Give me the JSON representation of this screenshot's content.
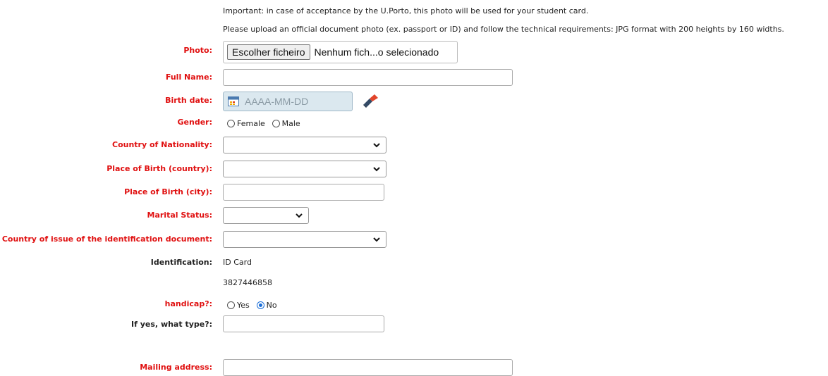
{
  "notes": {
    "line1": "Important: in case of acceptance by the U.Porto, this photo will be used for your student card.",
    "line2": "Please upload an official document photo (ex. passport or ID) and follow the technical requirements: JPG format with 200 heights by 160 widths."
  },
  "photo": {
    "label": "Photo:",
    "button": "Escolher ficheiro",
    "status": "Nenhum fich...o selecionado"
  },
  "full_name": {
    "label": "Full Name:",
    "value": ""
  },
  "birth_date": {
    "label": "Birth date:",
    "placeholder": "AAAA-MM-DD"
  },
  "gender": {
    "label": "Gender:",
    "options": [
      "Female",
      "Male"
    ],
    "selected": ""
  },
  "nationality": {
    "label": "Country of Nationality:",
    "value": ""
  },
  "birth_country": {
    "label": "Place of Birth (country):",
    "value": ""
  },
  "birth_city": {
    "label": "Place of Birth (city):",
    "value": ""
  },
  "marital": {
    "label": "Marital Status:",
    "value": ""
  },
  "id_country": {
    "label": "Country of issue of the identification document:",
    "value": ""
  },
  "identification": {
    "label": "Identification:",
    "type": "ID Card",
    "number": "3827446858"
  },
  "handicap": {
    "label": "handicap?:",
    "options": [
      "Yes",
      "No"
    ],
    "selected": "No"
  },
  "handicap_type": {
    "label": "If yes, what type?:",
    "value": ""
  },
  "mailing": {
    "label": "Mailing address:",
    "value": ""
  },
  "colors": {
    "required_label": "#e01010",
    "radio_selected": "#1a6ed8",
    "date_field_bg": "#dbe8ef"
  },
  "icons": {
    "calendar": "calendar-icon",
    "eraser": "eraser-icon",
    "dropdown": "chevron-down-icon"
  }
}
